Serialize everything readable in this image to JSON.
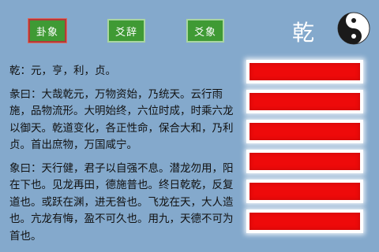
{
  "tabs": [
    {
      "label": "卦象",
      "active": true
    },
    {
      "label": "爻辞",
      "active": false
    },
    {
      "label": "爻象",
      "active": false
    }
  ],
  "hexagram": {
    "name": "乾",
    "icon": "yin-yang-icon",
    "lines": [
      "yang",
      "yang",
      "yang",
      "yang",
      "yang",
      "yang"
    ],
    "line_color": "#ee0a0a"
  },
  "text": {
    "judgment": "乾：元，亨，利，贞。",
    "tuan": "彖曰：大哉乾元，万物资始，乃统天。云行雨施，品物流形。大明始终，六位时成，时乘六龙以御天。乾道变化，各正性命，保合大和，乃利贞。首出庶物，万国咸宁。",
    "xiang": "象曰：天行健，君子以自强不息。潜龙勿用，阳在下也。见龙再田，德施普也。终日乾乾，反复道也。或跃在渊，进无咎也。飞龙在天，大人造也。亢龙有悔，盈不可久也。用九，天德不可为首也。"
  },
  "colors": {
    "background": "#84a9cc",
    "tab": "#3f9a34",
    "active_tab_border": "#b43a36"
  }
}
